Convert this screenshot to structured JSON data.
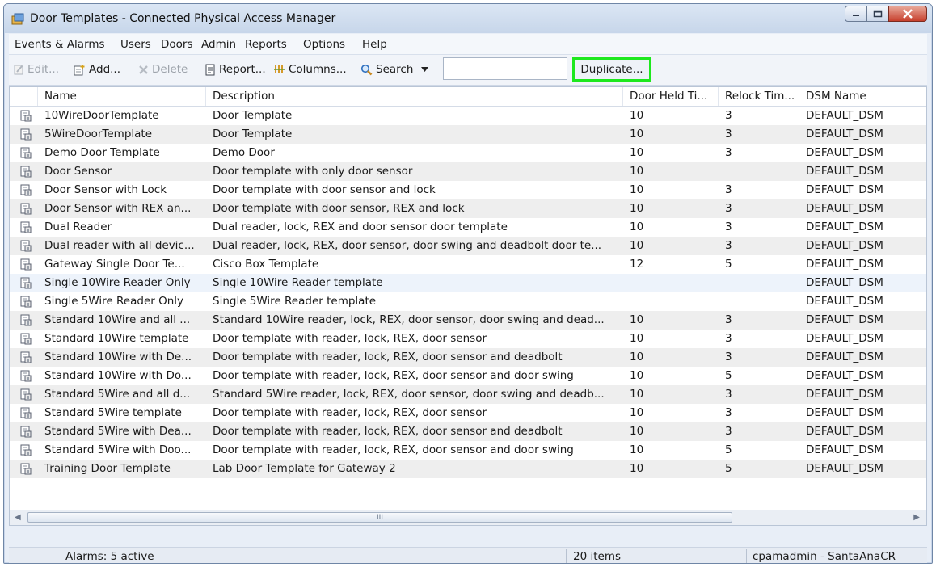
{
  "window": {
    "title": "Door Templates - Connected Physical Access Manager"
  },
  "menu": [
    "Events & Alarms",
    "Users",
    "Doors",
    "Admin",
    "Reports",
    "Options",
    "Help"
  ],
  "toolbar": {
    "edit": "Edit...",
    "add": "Add...",
    "delete": "Delete",
    "report": "Report...",
    "columns": "Columns...",
    "search": "Search",
    "search_value": "",
    "duplicate": "Duplicate..."
  },
  "columns": [
    "Name",
    "Description",
    "Door Held Ti...",
    "Relock Tim...",
    "DSM Name"
  ],
  "rows": [
    {
      "name": "10WireDoorTemplate",
      "desc": "Door Template",
      "held": "10",
      "relock": "3",
      "dsm": "DEFAULT_DSM"
    },
    {
      "name": "5WireDoorTemplate",
      "desc": "Door Template",
      "held": "10",
      "relock": "3",
      "dsm": "DEFAULT_DSM"
    },
    {
      "name": "Demo Door Template",
      "desc": "Demo Door",
      "held": "10",
      "relock": "3",
      "dsm": "DEFAULT_DSM"
    },
    {
      "name": "Door Sensor",
      "desc": "Door template with only door sensor",
      "held": "10",
      "relock": "",
      "dsm": "DEFAULT_DSM"
    },
    {
      "name": "Door Sensor with Lock",
      "desc": "Door template with door sensor and lock",
      "held": "10",
      "relock": "3",
      "dsm": "DEFAULT_DSM"
    },
    {
      "name": "Door Sensor with REX an...",
      "desc": "Door template with door sensor, REX and lock",
      "held": "10",
      "relock": "3",
      "dsm": "DEFAULT_DSM"
    },
    {
      "name": "Dual Reader",
      "desc": "Dual reader, lock, REX and door sensor door template",
      "held": "10",
      "relock": "3",
      "dsm": "DEFAULT_DSM"
    },
    {
      "name": "Dual reader with all devic...",
      "desc": "Dual reader, lock, REX, door sensor, door swing and deadbolt door te...",
      "held": "10",
      "relock": "3",
      "dsm": "DEFAULT_DSM"
    },
    {
      "name": "Gateway Single Door Te...",
      "desc": "Cisco Box Template",
      "held": "12",
      "relock": "5",
      "dsm": "DEFAULT_DSM"
    },
    {
      "name": "Single 10Wire Reader Only",
      "desc": "Single 10Wire Reader template",
      "held": "",
      "relock": "",
      "dsm": "DEFAULT_DSM"
    },
    {
      "name": "Single 5Wire Reader Only",
      "desc": "Single 5Wire Reader template",
      "held": "",
      "relock": "",
      "dsm": "DEFAULT_DSM"
    },
    {
      "name": "Standard 10Wire and all ...",
      "desc": "Standard 10Wire reader, lock, REX, door sensor, door swing and dead...",
      "held": "10",
      "relock": "3",
      "dsm": "DEFAULT_DSM"
    },
    {
      "name": "Standard 10Wire template",
      "desc": "Door template with reader, lock, REX, door sensor",
      "held": "10",
      "relock": "3",
      "dsm": "DEFAULT_DSM"
    },
    {
      "name": "Standard 10Wire with De...",
      "desc": "Door template with reader, lock, REX, door sensor and deadbolt",
      "held": "10",
      "relock": "3",
      "dsm": "DEFAULT_DSM"
    },
    {
      "name": "Standard 10Wire with Do...",
      "desc": "Door template with reader, lock, REX, door sensor and door swing",
      "held": "10",
      "relock": "5",
      "dsm": "DEFAULT_DSM"
    },
    {
      "name": "Standard 5Wire and all d...",
      "desc": "Standard 5Wire reader, lock, REX, door sensor, door swing and deadb...",
      "held": "10",
      "relock": "3",
      "dsm": "DEFAULT_DSM"
    },
    {
      "name": "Standard 5Wire template",
      "desc": "Door template with reader, lock, REX, door sensor",
      "held": "10",
      "relock": "3",
      "dsm": "DEFAULT_DSM"
    },
    {
      "name": "Standard 5Wire with Dea...",
      "desc": "Door template with reader, lock, REX, door sensor and deadbolt",
      "held": "10",
      "relock": "3",
      "dsm": "DEFAULT_DSM"
    },
    {
      "name": "Standard 5Wire with Doo...",
      "desc": "Door template with reader, lock, REX, door sensor and door swing",
      "held": "10",
      "relock": "5",
      "dsm": "DEFAULT_DSM"
    },
    {
      "name": "Training Door Template",
      "desc": "Lab Door Template for Gateway 2",
      "held": "10",
      "relock": "5",
      "dsm": "DEFAULT_DSM"
    }
  ],
  "scrollbar": {
    "grip": "III"
  },
  "status": {
    "alarms": "Alarms: 5 active",
    "items": "20 items",
    "user": "cpamadmin - SantaAnaCR"
  },
  "colors": {
    "highlight": "#1ee81e",
    "selected_row": "#edf3fb",
    "alt_row": "#eeeeee"
  }
}
